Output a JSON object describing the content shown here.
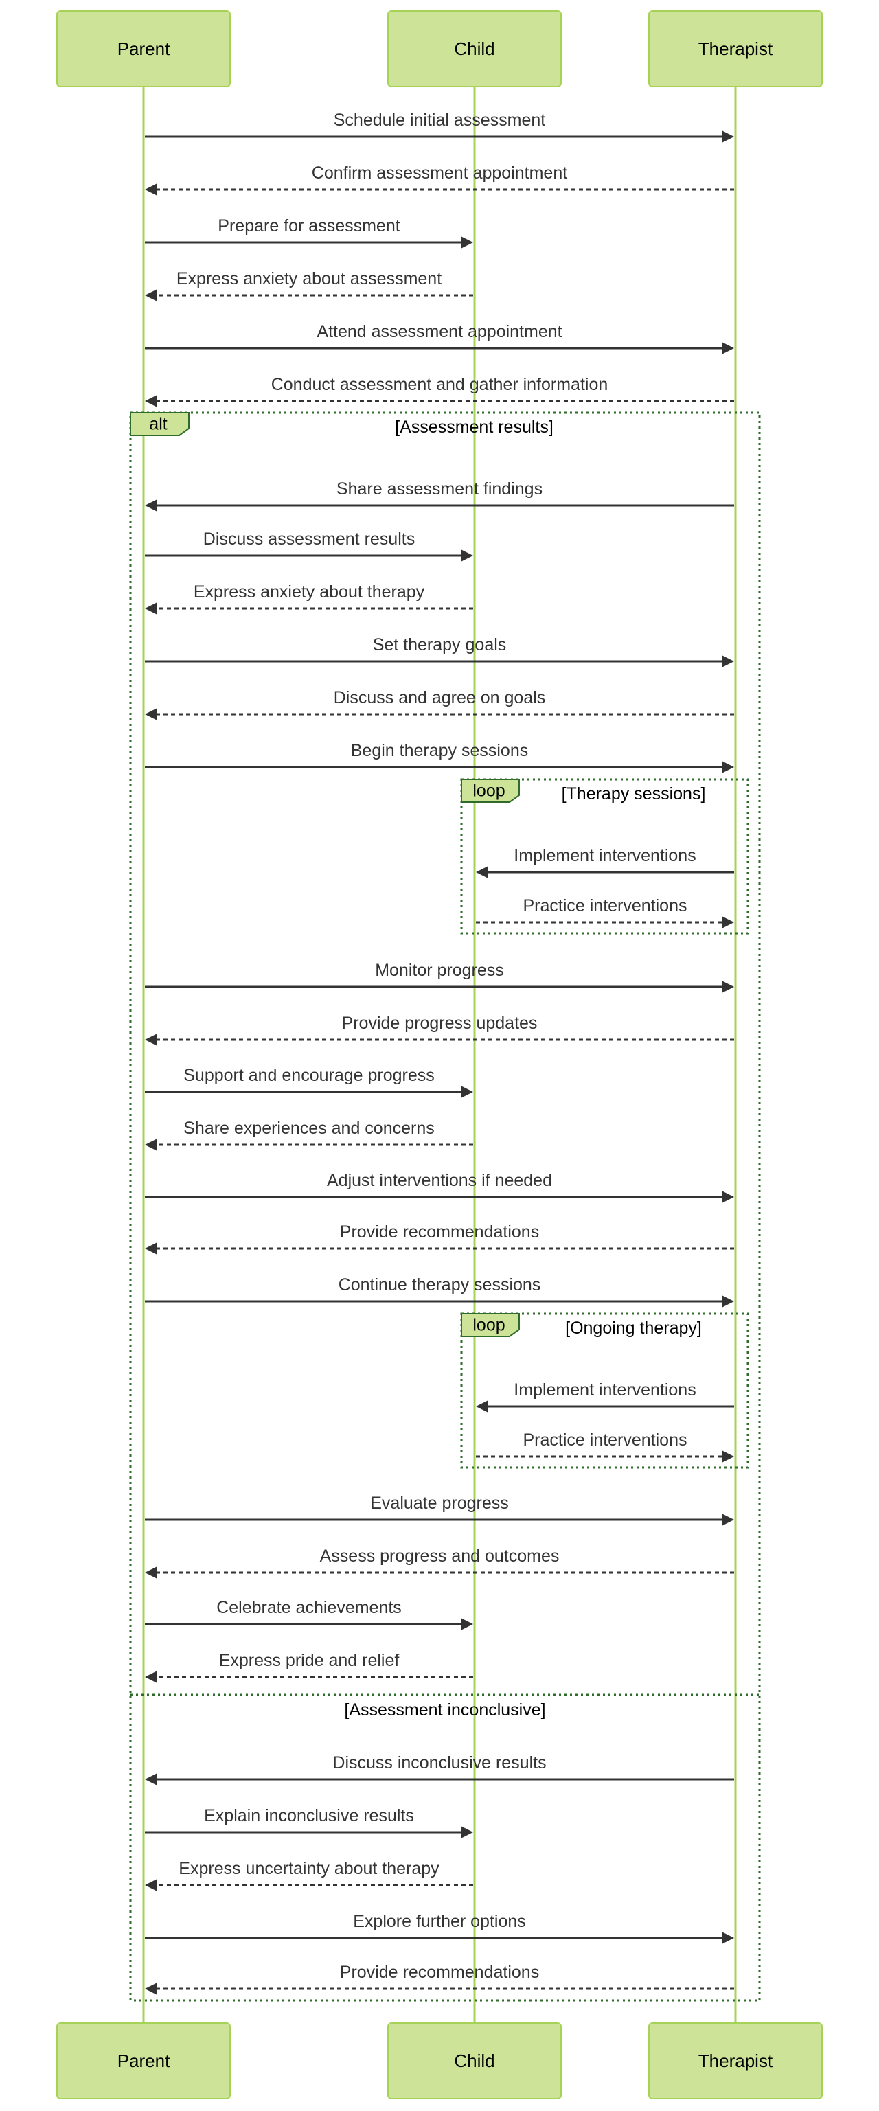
{
  "diagram": {
    "type": "sequence",
    "actors": [
      {
        "id": "parent",
        "label": "Parent"
      },
      {
        "id": "child",
        "label": "Child"
      },
      {
        "id": "therapist",
        "label": "Therapist"
      }
    ],
    "messages": [
      {
        "from": "parent",
        "to": "therapist",
        "style": "solid",
        "text": "Schedule initial assessment"
      },
      {
        "from": "therapist",
        "to": "parent",
        "style": "dashed",
        "text": "Confirm assessment appointment"
      },
      {
        "from": "parent",
        "to": "child",
        "style": "solid",
        "text": "Prepare for assessment"
      },
      {
        "from": "child",
        "to": "parent",
        "style": "dashed",
        "text": "Express anxiety about assessment"
      },
      {
        "from": "parent",
        "to": "therapist",
        "style": "solid",
        "text": "Attend assessment appointment"
      },
      {
        "from": "therapist",
        "to": "parent",
        "style": "dashed",
        "text": "Conduct assessment and gather information"
      },
      {
        "from": "therapist",
        "to": "parent",
        "style": "solid",
        "text": "Share assessment findings"
      },
      {
        "from": "parent",
        "to": "child",
        "style": "solid",
        "text": "Discuss assessment results"
      },
      {
        "from": "child",
        "to": "parent",
        "style": "dashed",
        "text": "Express anxiety about therapy"
      },
      {
        "from": "parent",
        "to": "therapist",
        "style": "solid",
        "text": "Set therapy goals"
      },
      {
        "from": "therapist",
        "to": "parent",
        "style": "dashed",
        "text": "Discuss and agree on goals"
      },
      {
        "from": "parent",
        "to": "therapist",
        "style": "solid",
        "text": "Begin therapy sessions"
      },
      {
        "from": "therapist",
        "to": "child",
        "style": "solid",
        "text": "Implement interventions"
      },
      {
        "from": "child",
        "to": "therapist",
        "style": "dashed",
        "text": "Practice interventions"
      },
      {
        "from": "parent",
        "to": "therapist",
        "style": "solid",
        "text": "Monitor progress"
      },
      {
        "from": "therapist",
        "to": "parent",
        "style": "dashed",
        "text": "Provide progress updates"
      },
      {
        "from": "parent",
        "to": "child",
        "style": "solid",
        "text": "Support and encourage progress"
      },
      {
        "from": "child",
        "to": "parent",
        "style": "dashed",
        "text": "Share experiences and concerns"
      },
      {
        "from": "parent",
        "to": "therapist",
        "style": "solid",
        "text": "Adjust interventions if needed"
      },
      {
        "from": "therapist",
        "to": "parent",
        "style": "dashed",
        "text": "Provide recommendations"
      },
      {
        "from": "parent",
        "to": "therapist",
        "style": "solid",
        "text": "Continue therapy sessions"
      },
      {
        "from": "therapist",
        "to": "child",
        "style": "solid",
        "text": "Implement interventions"
      },
      {
        "from": "child",
        "to": "therapist",
        "style": "dashed",
        "text": "Practice interventions"
      },
      {
        "from": "parent",
        "to": "therapist",
        "style": "solid",
        "text": "Evaluate progress"
      },
      {
        "from": "therapist",
        "to": "parent",
        "style": "dashed",
        "text": "Assess progress and outcomes"
      },
      {
        "from": "parent",
        "to": "child",
        "style": "solid",
        "text": "Celebrate achievements"
      },
      {
        "from": "child",
        "to": "parent",
        "style": "dashed",
        "text": "Express pride and relief"
      },
      {
        "from": "therapist",
        "to": "parent",
        "style": "solid",
        "text": "Discuss inconclusive results"
      },
      {
        "from": "parent",
        "to": "child",
        "style": "solid",
        "text": "Explain inconclusive results"
      },
      {
        "from": "child",
        "to": "parent",
        "style": "dashed",
        "text": "Express uncertainty about therapy"
      },
      {
        "from": "parent",
        "to": "therapist",
        "style": "solid",
        "text": "Explore further options"
      },
      {
        "from": "therapist",
        "to": "parent",
        "style": "dashed",
        "text": "Provide recommendations"
      }
    ],
    "frames": [
      {
        "kind": "alt",
        "label": "alt",
        "condition": "[Assessment results]",
        "first_message": 6,
        "last_message": 31,
        "else": {
          "condition": "[Assessment inconclusive]",
          "first_message": 27
        }
      },
      {
        "kind": "loop",
        "label": "loop",
        "condition": "[Therapy sessions]",
        "first_message": 12,
        "last_message": 13
      },
      {
        "kind": "loop",
        "label": "loop",
        "condition": "[Ongoing therapy]",
        "first_message": 21,
        "last_message": 22
      }
    ]
  }
}
